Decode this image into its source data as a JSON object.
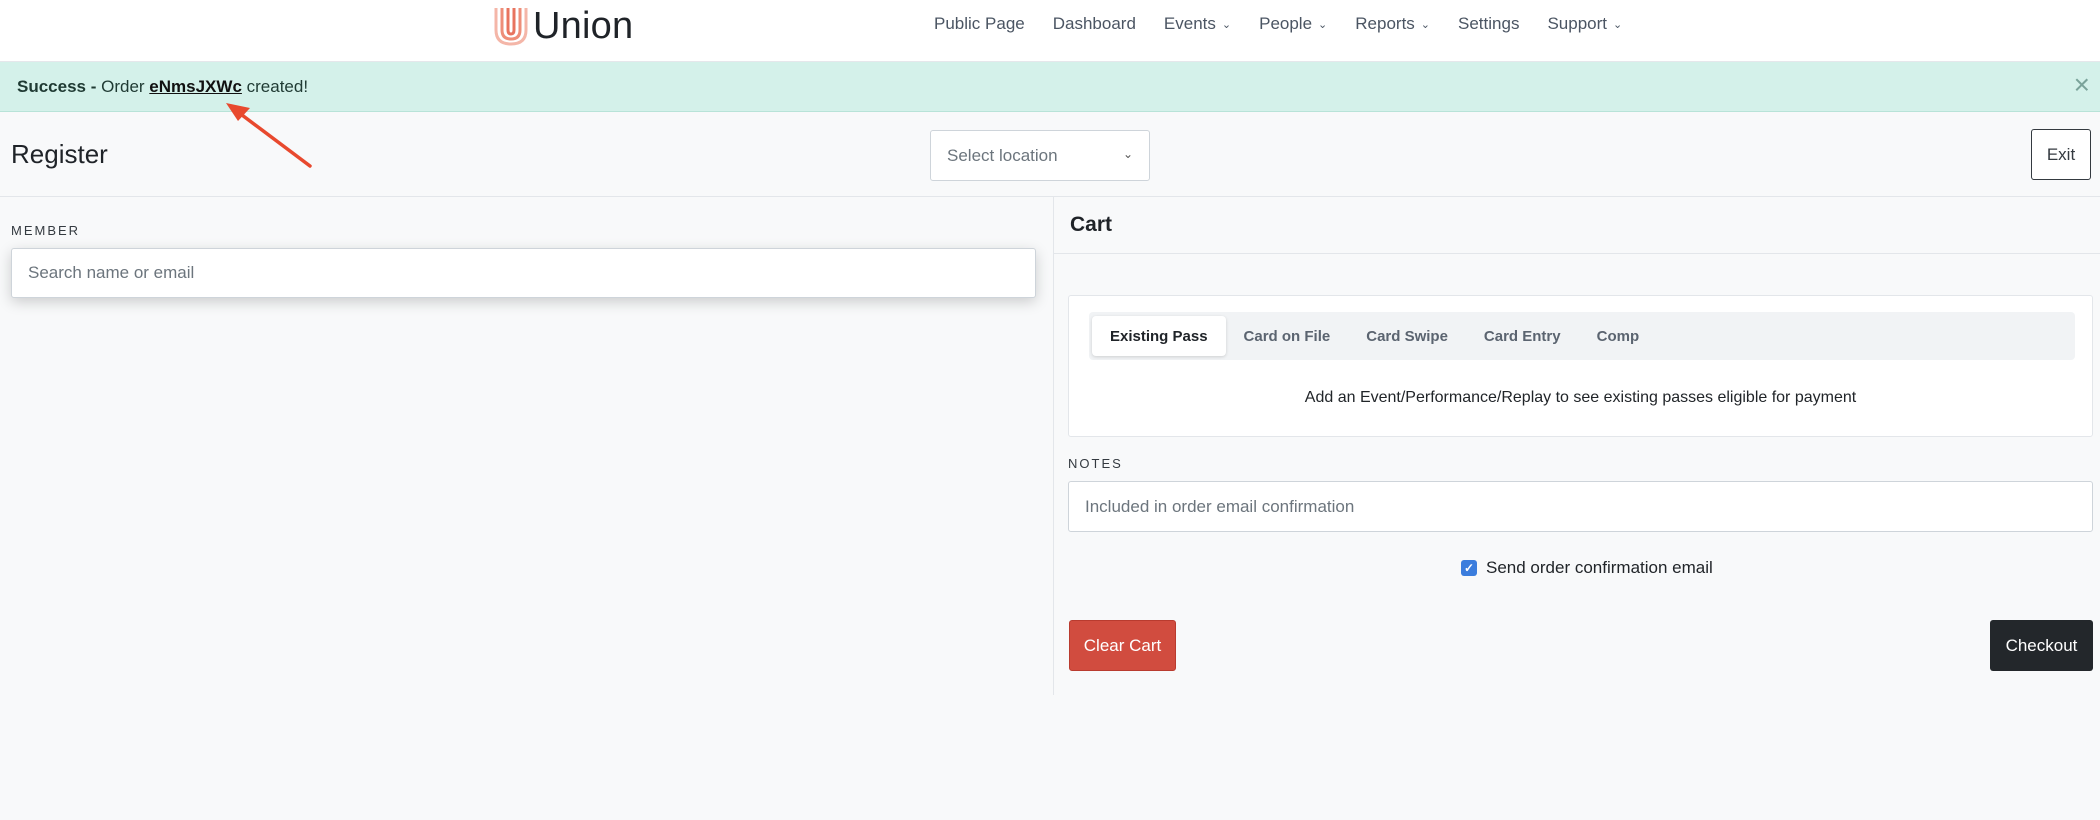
{
  "brand": {
    "name": "Union",
    "logo_icon": "union-logo-icon",
    "logo_color": "#e8745f"
  },
  "nav": {
    "items": [
      {
        "label": "Public Page",
        "dropdown": false
      },
      {
        "label": "Dashboard",
        "dropdown": false
      },
      {
        "label": "Events",
        "dropdown": true
      },
      {
        "label": "People",
        "dropdown": true
      },
      {
        "label": "Reports",
        "dropdown": true
      },
      {
        "label": "Settings",
        "dropdown": false
      },
      {
        "label": "Support",
        "dropdown": true
      }
    ]
  },
  "alert": {
    "status": "Success",
    "separator": " - ",
    "prefix": "Order ",
    "order_id": "eNmsJXWc",
    "suffix": " created!",
    "close_symbol": "×",
    "background": "#d4f1ea",
    "annotation_arrow_color": "#e8492e"
  },
  "register": {
    "title": "Register",
    "location_placeholder": "Select location",
    "exit_label": "Exit"
  },
  "member": {
    "label": "MEMBER",
    "search_placeholder": "Search name or email"
  },
  "cart": {
    "title": "Cart",
    "payment_tabs": [
      {
        "label": "Existing Pass",
        "active": true
      },
      {
        "label": "Card on File",
        "active": false
      },
      {
        "label": "Card Swipe",
        "active": false
      },
      {
        "label": "Card Entry",
        "active": false
      },
      {
        "label": "Comp",
        "active": false
      }
    ],
    "payment_message": "Add an Event/Performance/Replay to see existing passes eligible for payment",
    "notes_label": "NOTES",
    "notes_placeholder": "Included in order email confirmation",
    "send_confirmation_label": "Send order confirmation email",
    "send_confirmation_checked": true,
    "clear_label": "Clear Cart",
    "checkout_label": "Checkout",
    "clear_color": "#d14c3f",
    "checkout_color": "#23272b"
  }
}
